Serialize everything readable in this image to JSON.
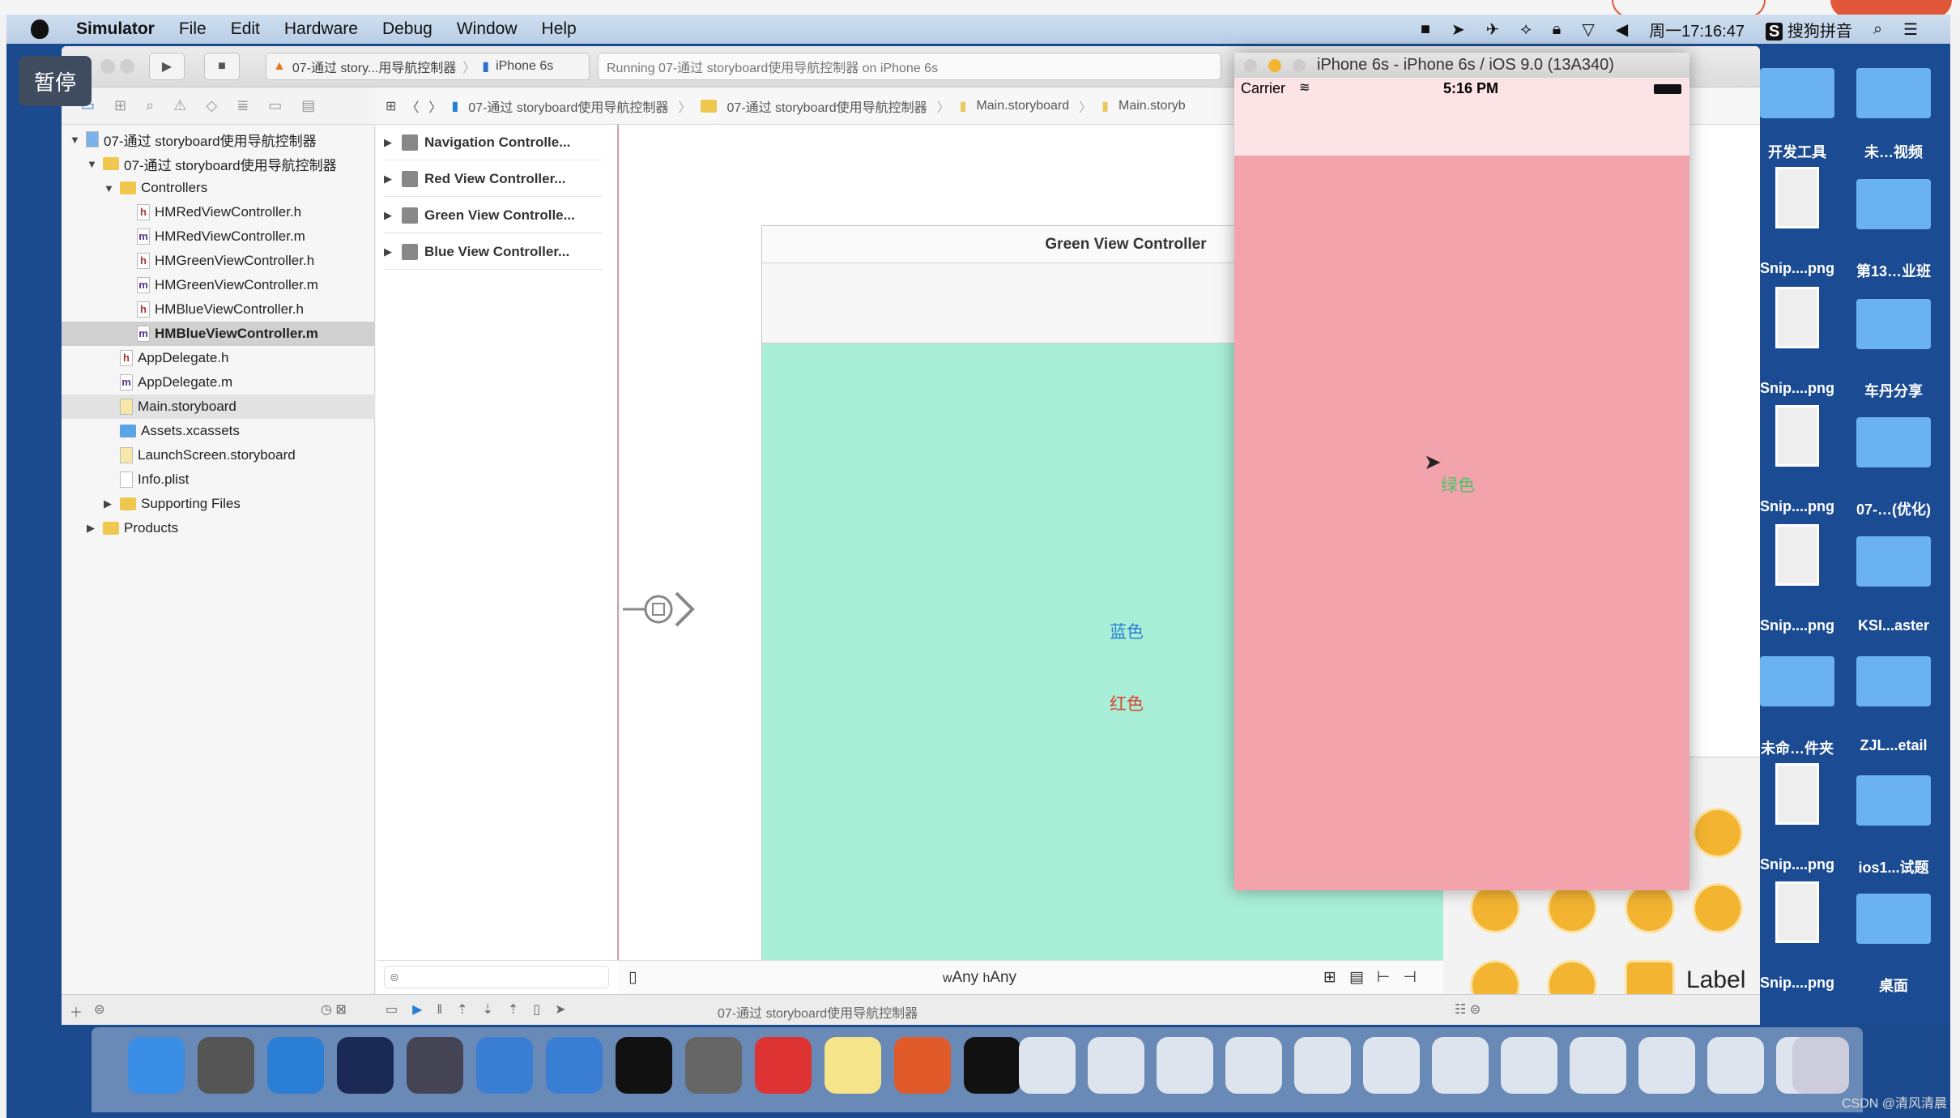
{
  "menubar": {
    "app": "Simulator",
    "items": [
      "File",
      "Edit",
      "Hardware",
      "Debug",
      "Window",
      "Help"
    ],
    "clock": "周一17:16:47",
    "ime": "搜狗拼音"
  },
  "overlay": {
    "pause": "暂停"
  },
  "toolbar": {
    "scheme": "07-通过 story...用导航控制器",
    "device": "iPhone 6s",
    "activity": "Running 07-通过 storyboard使用导航控制器 on iPhone 6s"
  },
  "jumpbar": [
    "07-通过 storyboard使用导航控制器",
    "07-通过 storyboard使用导航控制器",
    "Main.storyboard",
    "Main.storyb"
  ],
  "navigator": {
    "rows": [
      {
        "label": "07-通过 storyboard使用导航控制器",
        "icon": "project",
        "indent": 0,
        "tri": "▼"
      },
      {
        "label": "07-通过 storyboard使用导航控制器",
        "icon": "folder",
        "indent": 1,
        "tri": "▼"
      },
      {
        "label": "Controllers",
        "icon": "folder",
        "indent": 2,
        "tri": "▼"
      },
      {
        "label": "HMRedViewController.h",
        "icon": "h",
        "indent": 3,
        "tri": ""
      },
      {
        "label": "HMRedViewController.m",
        "icon": "m",
        "indent": 3,
        "tri": ""
      },
      {
        "label": "HMGreenViewController.h",
        "icon": "h",
        "indent": 3,
        "tri": ""
      },
      {
        "label": "HMGreenViewController.m",
        "icon": "m",
        "indent": 3,
        "tri": ""
      },
      {
        "label": "HMBlueViewController.h",
        "icon": "h",
        "indent": 3,
        "tri": ""
      },
      {
        "label": "HMBlueViewController.m",
        "icon": "m",
        "indent": 3,
        "tri": "",
        "selected": true
      },
      {
        "label": "AppDelegate.h",
        "icon": "h",
        "indent": 2,
        "tri": ""
      },
      {
        "label": "AppDelegate.m",
        "icon": "m",
        "indent": 2,
        "tri": ""
      },
      {
        "label": "Main.storyboard",
        "icon": "storyboard",
        "indent": 2,
        "tri": "",
        "highlight": true
      },
      {
        "label": "Assets.xcassets",
        "icon": "assets",
        "indent": 2,
        "tri": ""
      },
      {
        "label": "LaunchScreen.storyboard",
        "icon": "storyboard",
        "indent": 2,
        "tri": ""
      },
      {
        "label": "Info.plist",
        "icon": "plist",
        "indent": 2,
        "tri": ""
      },
      {
        "label": "Supporting Files",
        "icon": "folder",
        "indent": 2,
        "tri": "▶"
      },
      {
        "label": "Products",
        "icon": "folder",
        "indent": 1,
        "tri": "▶"
      }
    ]
  },
  "outline": [
    "Navigation Controlle...",
    "Red View Controller...",
    "Green View Controlle...",
    "Blue View Controller..."
  ],
  "scene": {
    "title": "Green View Controller",
    "blue_label": "蓝色",
    "red_label": "红色",
    "blue_color": "#2a7fd4",
    "red_color": "#d9432f",
    "bg": "#a9eed6"
  },
  "simulator": {
    "title": "iPhone 6s - iPhone 6s / iOS 9.0 (13A340)",
    "carrier": "Carrier",
    "time": "5:16 PM",
    "label": "绿色",
    "label_color": "#4cc46a",
    "bg": "#f2a3ab"
  },
  "canvas_bar": {
    "size_class_w": "w",
    "size_class_w_val": "Any",
    "size_class_h": "h",
    "size_class_h_val": "Any"
  },
  "library": {
    "label_item": "Label"
  },
  "debugbar": {
    "target": "07-通过 storyboard使用导航控制器"
  },
  "desktop": {
    "items": [
      {
        "label": "开发工具",
        "type": "folder"
      },
      {
        "label": "未…视频",
        "type": "folder"
      },
      {
        "label": "Snip....png",
        "type": "thumb"
      },
      {
        "label": "第13…业班",
        "type": "folder"
      },
      {
        "label": "Snip....png",
        "type": "thumb"
      },
      {
        "label": "车丹分享",
        "type": "folder"
      },
      {
        "label": "Snip....png",
        "type": "thumb"
      },
      {
        "label": "07-…(优化)",
        "type": "folder"
      },
      {
        "label": "Snip....png",
        "type": "thumb"
      },
      {
        "label": "KSI...aster",
        "type": "folder"
      },
      {
        "label": "未命…件夹",
        "type": "folder"
      },
      {
        "label": "ZJL...etail",
        "type": "folder"
      },
      {
        "label": "Snip....png",
        "type": "thumb"
      },
      {
        "label": "ios1...试题",
        "type": "folder"
      },
      {
        "label": "Snip....png",
        "type": "thumb"
      },
      {
        "label": "桌面",
        "type": "folder"
      }
    ]
  },
  "watermark": "CSDN @清风清晨"
}
